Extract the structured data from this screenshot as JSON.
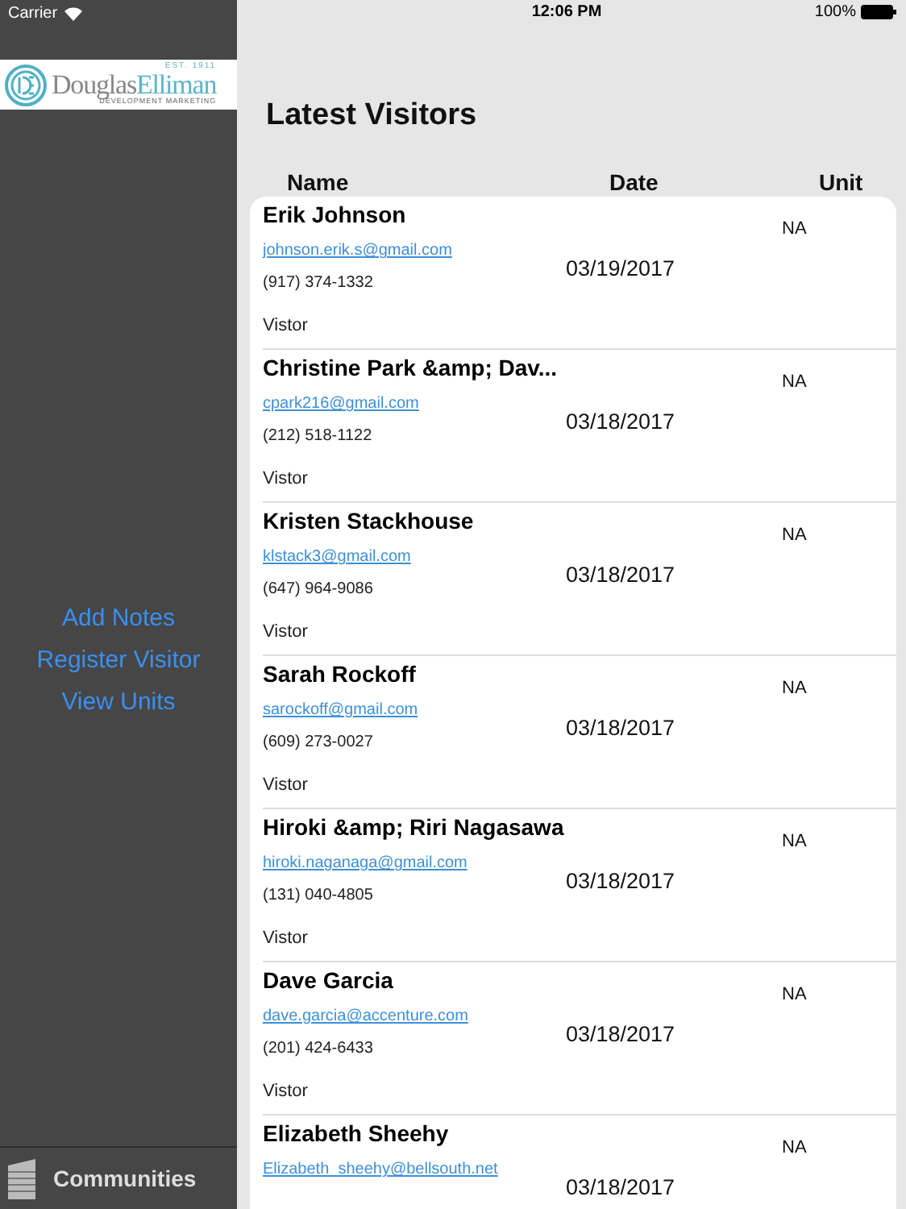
{
  "status_bar": {
    "carrier": "Carrier",
    "time": "12:06 PM",
    "battery": "100%"
  },
  "logo": {
    "first": "Douglas",
    "second": "Elliman",
    "est": "EST. 1911",
    "tagline": "DEVELOPMENT MARKETING"
  },
  "sidebar": {
    "items": [
      {
        "label": "Add Notes"
      },
      {
        "label": "Register Visitor"
      },
      {
        "label": "View Units"
      }
    ],
    "footer": "Communities"
  },
  "title": "Latest Visitors",
  "table": {
    "columns": [
      "Name",
      "Date",
      "Unit"
    ],
    "rows": [
      {
        "name": "Erik Johnson",
        "email": "johnson.erik.s@gmail.com",
        "phone": "(917) 374-1332",
        "type": "Vistor",
        "date": "03/19/2017",
        "unit": "NA"
      },
      {
        "name": "Christine Park &amp; Dav...",
        "email": "cpark216@gmail.com",
        "phone": "(212) 518-1122",
        "type": "Vistor",
        "date": "03/18/2017",
        "unit": "NA"
      },
      {
        "name": "Kristen Stackhouse",
        "email": "klstack3@gmail.com",
        "phone": "(647) 964-9086",
        "type": "Vistor",
        "date": "03/18/2017",
        "unit": "NA"
      },
      {
        "name": "Sarah Rockoff",
        "email": "sarockoff@gmail.com",
        "phone": "(609) 273-0027",
        "type": "Vistor",
        "date": "03/18/2017",
        "unit": "NA"
      },
      {
        "name": "Hiroki &amp; Riri Nagasawa",
        "email": "hiroki.naganaga@gmail.com",
        "phone": "(131) 040-4805",
        "type": "Vistor",
        "date": "03/18/2017",
        "unit": "NA"
      },
      {
        "name": "Dave Garcia",
        "email": "dave.garcia@accenture.com",
        "phone": "(201) 424-6433",
        "type": "Vistor",
        "date": "03/18/2017",
        "unit": "NA"
      },
      {
        "name": "Elizabeth Sheehy",
        "email": "Elizabeth_sheehy@bellsouth.net",
        "date": "03/18/2017",
        "unit": "NA"
      }
    ]
  }
}
